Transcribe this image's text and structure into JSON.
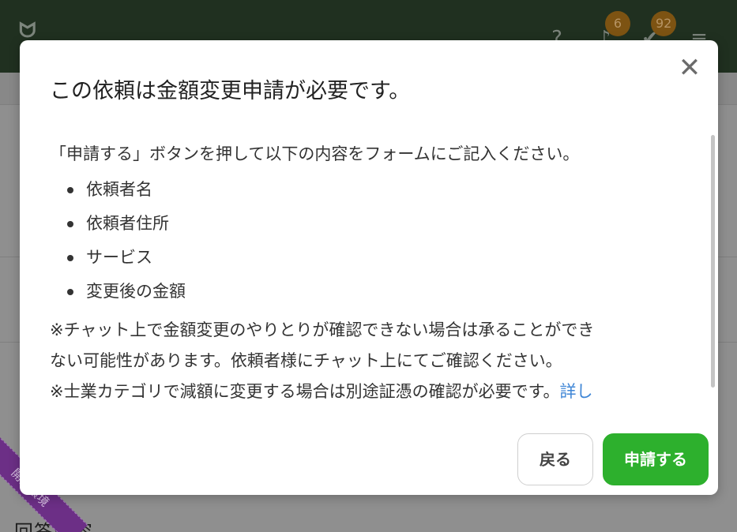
{
  "header": {
    "help_icon": "help-circle-icon",
    "notification_icon": "bell-icon",
    "notification_count": "6",
    "task_icon": "task-check-icon",
    "task_count": "92",
    "menu_icon": "hamburger-menu-icon"
  },
  "background": {
    "bottom_text": "回答内容",
    "ribbon_label": "開発環境"
  },
  "modal": {
    "title": "この依頼は金額変更申請が必要です。",
    "intro": "「申請する」ボタンを押して以下の内容をフォームにご記入ください。",
    "items": [
      "依頼者名",
      "依頼者住所",
      "サービス",
      "変更後の金額"
    ],
    "note1_line1": "※チャット上で金額変更のやりとりが確認できない場合は承ることができ",
    "note1_line2": "ない可能性があります。依頼者様にチャット上にてご確認ください。",
    "note2_text": "※士業カテゴリで減額に変更する場合は別途証憑の確認が必要です。",
    "note2_link": "詳し",
    "back_label": "戻る",
    "apply_label": "申請する"
  },
  "colors": {
    "header_bg": "#203020",
    "primary_button": "#2db02d",
    "link": "#3f86d6",
    "badge": "#7d5312",
    "ribbon": "#6c2f86"
  }
}
